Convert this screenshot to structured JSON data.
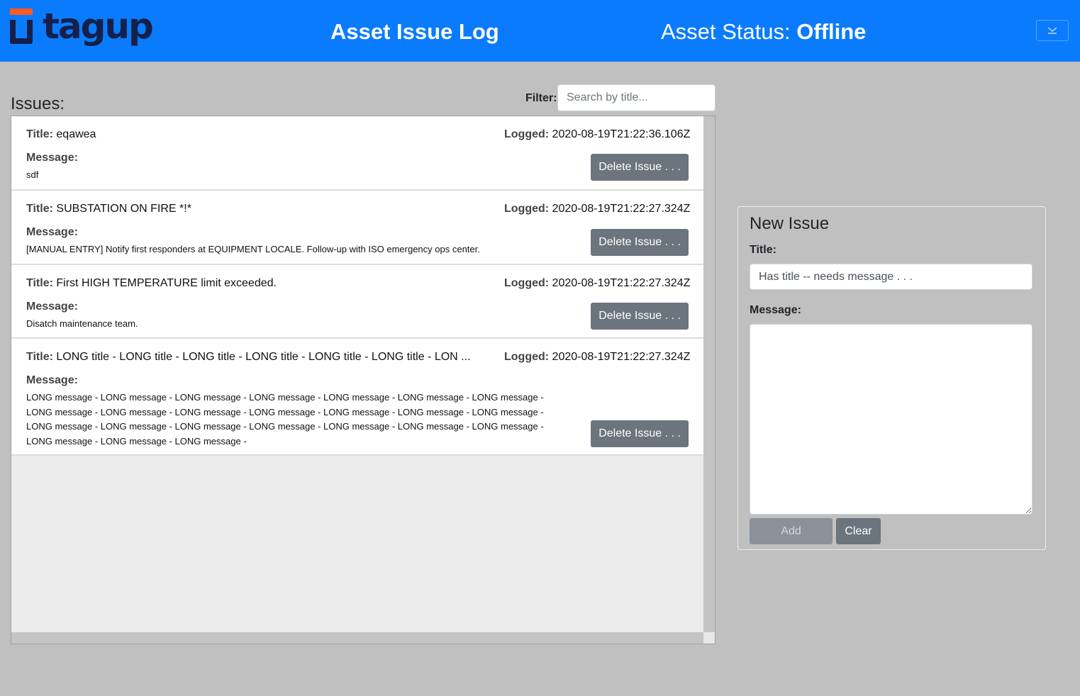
{
  "header": {
    "logo_text": "tagup",
    "app_title": "Asset Issue Log",
    "status_label": "Asset Status: ",
    "status_value": "Offline",
    "menu_icon": "chevron-down-icon"
  },
  "issues_panel": {
    "heading": "Issues:",
    "filter_label": "Filter:",
    "filter_placeholder": "Search by title...",
    "filter_value": ""
  },
  "issues": [
    {
      "title_label": "Title:",
      "title": "eqawea",
      "logged_label": "Logged:",
      "logged": "2020-08-19T21:22:36.106Z",
      "message_label": "Message:",
      "message": "sdf",
      "delete_label": "Delete Issue . . ."
    },
    {
      "title_label": "Title:",
      "title": "SUBSTATION ON FIRE *!*",
      "logged_label": "Logged:",
      "logged": "2020-08-19T21:22:27.324Z",
      "message_label": "Message:",
      "message": "[MANUAL ENTRY] Notify first responders at EQUIPMENT LOCALE. Follow-up with ISO emergency ops center.",
      "delete_label": "Delete Issue . . ."
    },
    {
      "title_label": "Title:",
      "title": "First HIGH TEMPERATURE limit exceeded.",
      "logged_label": "Logged:",
      "logged": "2020-08-19T21:22:27.324Z",
      "message_label": "Message:",
      "message": "Disatch maintenance team.",
      "delete_label": "Delete Issue . . ."
    },
    {
      "title_label": "Title:",
      "title": "LONG title - LONG title - LONG title - LONG title - LONG title - LONG title - LON   ...",
      "logged_label": "Logged:",
      "logged": "2020-08-19T21:22:27.324Z",
      "message_label": "Message:",
      "message": "LONG message - LONG message - LONG message - LONG message - LONG message - LONG message - LONG message - LONG message - LONG message - LONG message - LONG message - LONG message - LONG message - LONG message - LONG message - LONG message - LONG message - LONG message - LONG message - LONG message - LONG message - LONG message - LONG message - LONG message -",
      "delete_label": "Delete Issue . . ."
    }
  ],
  "new_issue": {
    "heading": "New Issue",
    "title_label": "Title:",
    "title_value": "Has title -- needs message . . .",
    "message_label": "Message:",
    "message_value": "",
    "add_label": "Add",
    "clear_label": "Clear"
  },
  "colors": {
    "header_bg": "#0b7bfd",
    "page_bg": "#c0c0c0",
    "logo_accent": "#ff5a1f",
    "logo_navy": "#15204a",
    "button_gray": "#6c757d"
  }
}
